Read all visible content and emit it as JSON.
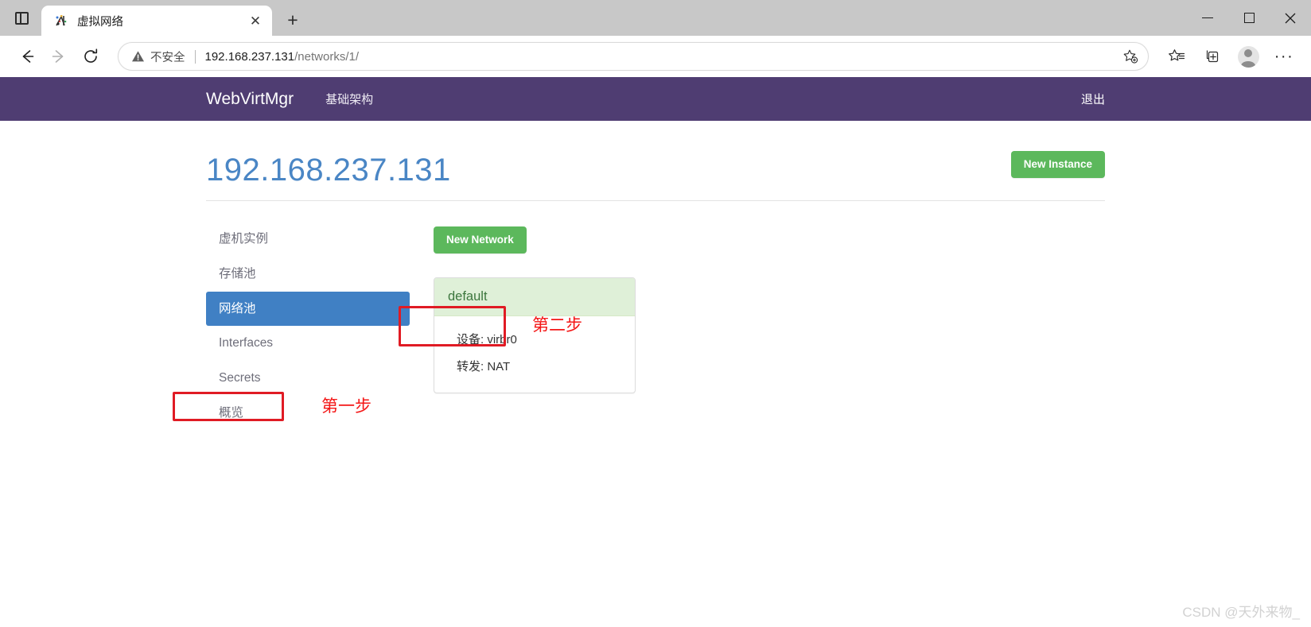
{
  "browser": {
    "tab": {
      "title": "虚拟网络",
      "favicon": "network-favicon",
      "close_label": "✕"
    },
    "new_tab_label": "+",
    "window_controls": {
      "minimize": "minimize-icon",
      "maximize": "maximize-icon",
      "close": "close-icon"
    },
    "omnibox": {
      "security_label": "不安全",
      "security_icon": "warning-triangle-icon",
      "url_host": "192.168.237.131",
      "url_path": "/networks/1/",
      "full_url": "192.168.237.131/networks/1/",
      "favorite_icon": "add-favorite-star-icon"
    },
    "toolbar": {
      "back_icon": "back-arrow-icon",
      "forward_icon": "forward-arrow-icon",
      "refresh_icon": "refresh-icon",
      "favorites_icon": "favorites-list-icon",
      "collections_icon": "collections-icon",
      "profile_icon": "profile-avatar-icon",
      "settings_icon": "more-options-icon",
      "settings_glyph": "···"
    }
  },
  "navbar": {
    "brand": "WebVirtMgr",
    "links": [
      {
        "label": "基础架构",
        "name": "nav-link-infrastructure"
      }
    ],
    "logout": "退出"
  },
  "header": {
    "title": "192.168.237.131",
    "new_instance_label": "New Instance"
  },
  "sidebar": {
    "items": [
      {
        "label": "虚机实例",
        "active": false
      },
      {
        "label": "存储池",
        "active": false
      },
      {
        "label": "网络池",
        "active": true
      },
      {
        "label": "Interfaces",
        "active": false
      },
      {
        "label": "Secrets",
        "active": false
      },
      {
        "label": "概览",
        "active": false
      }
    ]
  },
  "content": {
    "new_network_label": "New Network",
    "network_card": {
      "name": "default",
      "props": [
        {
          "label": "设备:",
          "value": "virbr0",
          "text": "设备: virbr0"
        },
        {
          "label": "转发:",
          "value": "NAT",
          "text": "转发: NAT"
        }
      ]
    }
  },
  "annotations": [
    {
      "text": "第一步",
      "target": "网络池"
    },
    {
      "text": "第二步",
      "target": "New Network"
    }
  ],
  "annotation_step1": "第一步",
  "annotation_step2": "第二步",
  "watermark": "CSDN @天外来物_",
  "colors": {
    "navbar_purple": "#4f3d72",
    "title_blue": "#4a86c5",
    "active_blue": "#4080c4",
    "green_button": "#5cb85c",
    "card_header_green": "#dff0d8",
    "card_header_text": "#3c763d",
    "annotation_red": "#e01b24"
  }
}
